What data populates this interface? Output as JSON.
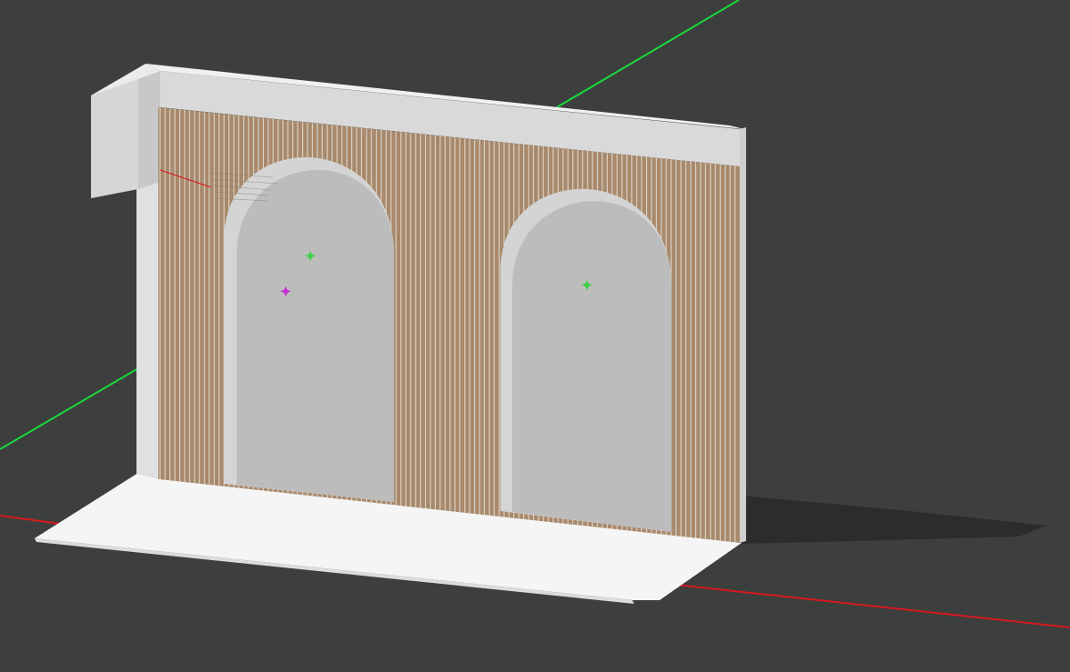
{
  "viewport": {
    "background_color": "#3d3e3e",
    "axes": {
      "x_axis": {
        "label": "red-axis",
        "color": "#d6181f"
      },
      "y_axis": {
        "label": "green-axis",
        "color": "#19d83b"
      }
    },
    "model": {
      "floor_color": "#f5f5f5",
      "wall_frame_color": "#d9d9d9",
      "wall_side_color": "#c9c9c9",
      "slat_base_color": "#a8896b",
      "slat_line_color": "#d8cfc3",
      "arch_fill_color": "#bcbcbc",
      "arch_edge_color": "#d4d4d4",
      "shadow_color": "#2b2c2c"
    },
    "markers": {
      "arch_center_color": "#3bd14a",
      "magenta_marker_color": "#c42fd1"
    }
  }
}
